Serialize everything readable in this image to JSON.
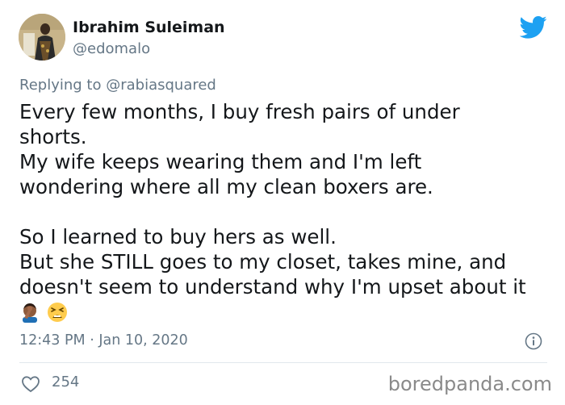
{
  "author": {
    "display_name": "Ibrahim Suleiman",
    "handle": "@edomalo",
    "avatar_icon": "avatar-photo"
  },
  "platform_icon": "twitter-bird-icon",
  "reply": {
    "prefix": "Replying to",
    "mention": "@rabiasquared"
  },
  "tweet": {
    "lines": [
      "Every few months, I buy fresh pairs of under",
      "shorts.",
      "My wife keeps wearing them and I'm left",
      "wondering where all my clean boxers are.",
      "",
      "So I learned to buy hers as well.",
      "But she STILL goes to my closet, takes mine, and",
      "doesn't seem to understand why I'm upset about it"
    ],
    "emojis": [
      "man-facepalming-emoji",
      "tired-face-emoji"
    ]
  },
  "meta": {
    "timestamp": "12:43 PM · Jan 10, 2020"
  },
  "engagement": {
    "likes": "254"
  },
  "watermark": "boredpanda.com",
  "colors": {
    "twitter_blue": "#1da1f2",
    "muted_text": "#657786",
    "body_text": "#14171a",
    "divider": "#e1e8ed"
  }
}
